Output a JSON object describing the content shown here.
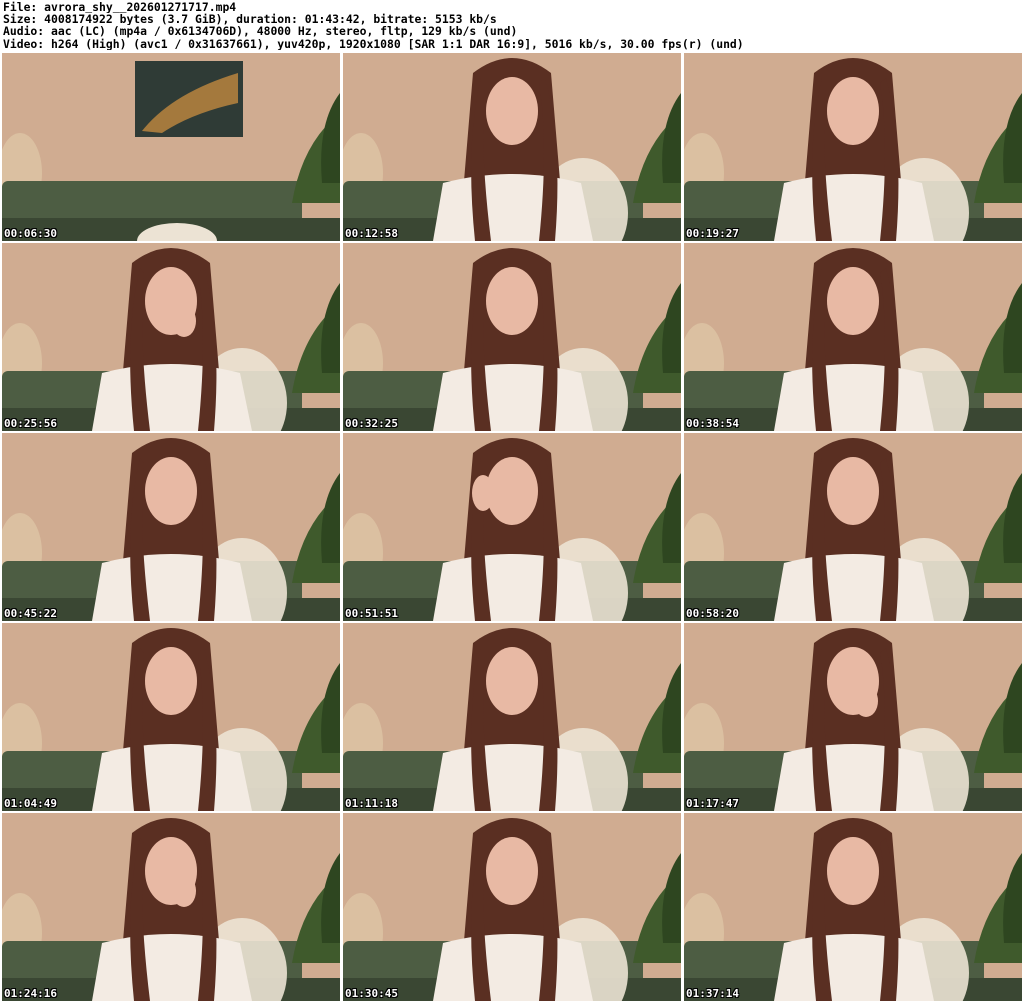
{
  "header": {
    "file_line": "File: avrora_shy__202601271717.mp4",
    "size_line": "Size: 4008174922 bytes (3.7 GiB), duration: 01:43:42, bitrate: 5153 kb/s",
    "audio_line": "Audio: aac (LC) (mp4a / 0x6134706D), 48000 Hz, stereo, fltp, 129 kb/s (und)",
    "video_line": "Video: h264 (High) (avc1 / 0x31637661), yuv420p, 1920x1080 [SAR 1:1 DAR 16:9], 5016 kb/s, 30.00 fps(r) (und)"
  },
  "thumbnails": [
    {
      "timestamp": "00:06:30",
      "figure": false,
      "painting": true,
      "hand": "none"
    },
    {
      "timestamp": "00:12:58",
      "figure": true,
      "painting": false,
      "hand": "none"
    },
    {
      "timestamp": "00:19:27",
      "figure": true,
      "painting": false,
      "hand": "none"
    },
    {
      "timestamp": "00:25:56",
      "figure": true,
      "painting": false,
      "hand": "face"
    },
    {
      "timestamp": "00:32:25",
      "figure": true,
      "painting": false,
      "hand": "none"
    },
    {
      "timestamp": "00:38:54",
      "figure": true,
      "painting": false,
      "hand": "none"
    },
    {
      "timestamp": "00:45:22",
      "figure": true,
      "painting": false,
      "hand": "none"
    },
    {
      "timestamp": "00:51:51",
      "figure": true,
      "painting": false,
      "hand": "raised"
    },
    {
      "timestamp": "00:58:20",
      "figure": true,
      "painting": false,
      "hand": "none"
    },
    {
      "timestamp": "01:04:49",
      "figure": true,
      "painting": false,
      "hand": "none"
    },
    {
      "timestamp": "01:11:18",
      "figure": true,
      "painting": false,
      "hand": "none"
    },
    {
      "timestamp": "01:17:47",
      "figure": true,
      "painting": false,
      "hand": "face"
    },
    {
      "timestamp": "01:24:16",
      "figure": true,
      "painting": false,
      "hand": "face"
    },
    {
      "timestamp": "01:30:45",
      "figure": true,
      "painting": false,
      "hand": "none"
    },
    {
      "timestamp": "01:37:14",
      "figure": true,
      "painting": false,
      "hand": "none"
    }
  ],
  "colors": {
    "wall": "#d8b59a",
    "wall_shadow": "#b89378",
    "sofa": "#4d5d43",
    "sofa_dark": "#3a4733",
    "floor": "#8a6a54",
    "plant": "#3f5a2c",
    "pampas": "#e0c9a8",
    "hair": "#5a2f22",
    "skin": "#e8b9a4",
    "top": "#f3ebe3",
    "blanket": "#ece3d4"
  }
}
